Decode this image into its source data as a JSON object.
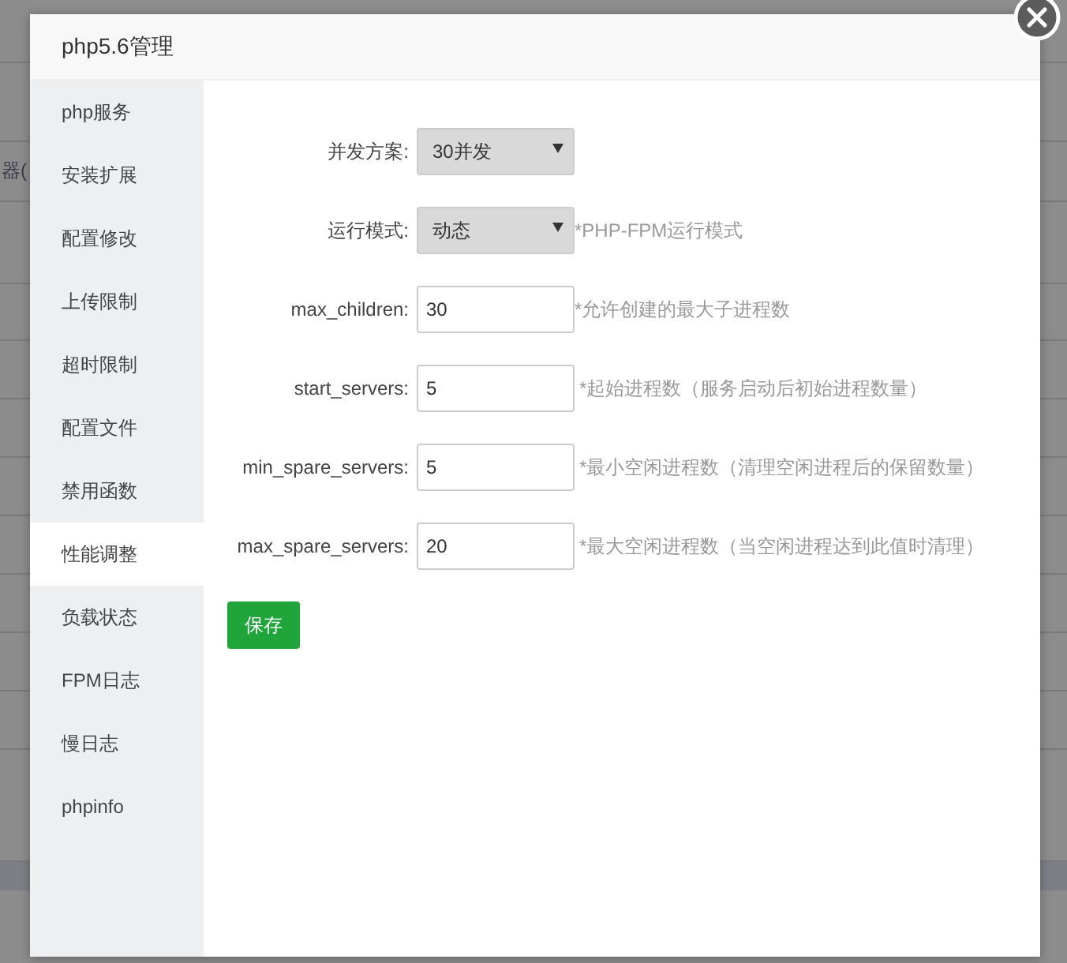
{
  "background": {
    "cut_text": "器("
  },
  "dialog": {
    "title": "php5.6管理"
  },
  "sidebar": {
    "items": [
      {
        "label": "php服务",
        "selected": false
      },
      {
        "label": "安装扩展",
        "selected": false
      },
      {
        "label": "配置修改",
        "selected": false
      },
      {
        "label": "上传限制",
        "selected": false
      },
      {
        "label": "超时限制",
        "selected": false
      },
      {
        "label": "配置文件",
        "selected": false
      },
      {
        "label": "禁用函数",
        "selected": false
      },
      {
        "label": "性能调整",
        "selected": true
      },
      {
        "label": "负载状态",
        "selected": false
      },
      {
        "label": "FPM日志",
        "selected": false
      },
      {
        "label": "慢日志",
        "selected": false
      },
      {
        "label": "phpinfo",
        "selected": false
      }
    ]
  },
  "form": {
    "fields": [
      {
        "kind": "select",
        "label": "并发方案:",
        "value": "30并发"
      },
      {
        "kind": "select",
        "label": "运行模式:",
        "value": "动态",
        "hint": "*PHP-FPM运行模式"
      },
      {
        "kind": "input",
        "label": "max_children:",
        "value": "30",
        "hint": "*允许创建的最大子进程数"
      },
      {
        "kind": "input",
        "label": "start_servers:",
        "value": "5",
        "hint": "*起始进程数（服务启动后初始进程数量）"
      },
      {
        "kind": "input",
        "label": "min_spare_servers:",
        "value": "5",
        "hint": "*最小空闲进程数（清理空闲进程后的保留数量）"
      },
      {
        "kind": "input",
        "label": "max_spare_servers:",
        "value": "20",
        "hint": "*最大空闲进程数（当空闲进程达到此值时清理）"
      }
    ],
    "save_button": "保存"
  }
}
